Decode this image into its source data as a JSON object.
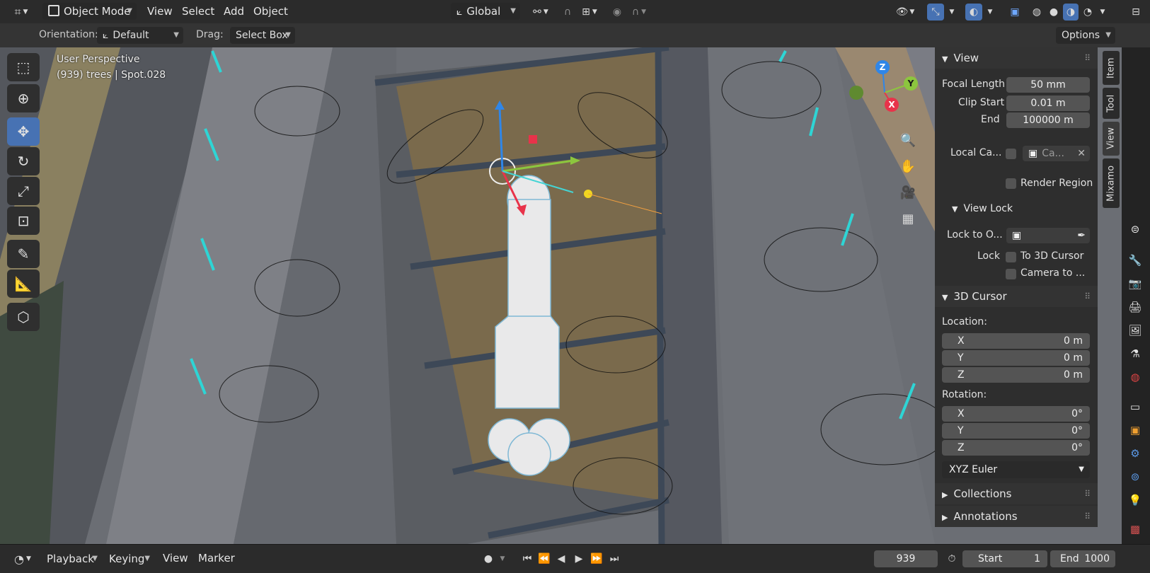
{
  "header": {
    "mode": "Object Mode",
    "menus": [
      "View",
      "Select",
      "Add",
      "Object"
    ],
    "transform_orientation": "Global"
  },
  "tool_options": {
    "orientation_label": "Orientation:",
    "orientation_value": "Default",
    "drag_label": "Drag:",
    "drag_value": "Select Box",
    "options_label": "Options"
  },
  "viewport": {
    "perspective": "User Perspective",
    "object_info": "(939) trees | Spot.028"
  },
  "gizmo_axes": [
    "Z",
    "Y",
    "X"
  ],
  "npanel": {
    "view_header": "View",
    "focal_length_label": "Focal Length",
    "focal_length_value": "50 mm",
    "clip_start_label": "Clip Start",
    "clip_start_value": "0.01 m",
    "clip_end_label": "End",
    "clip_end_value": "100000 m",
    "local_camera_label": "Local Ca...",
    "local_camera_value": "Ca...",
    "render_region_label": "Render Region",
    "view_lock_header": "View Lock",
    "lock_to_object_label": "Lock to O...",
    "lock_label": "Lock",
    "to_3d_cursor_label": "To 3D Cursor",
    "camera_to_label": "Camera to ...",
    "cursor_header": "3D Cursor",
    "location_label": "Location:",
    "location": [
      {
        "axis": "X",
        "value": "0 m"
      },
      {
        "axis": "Y",
        "value": "0 m"
      },
      {
        "axis": "Z",
        "value": "0 m"
      }
    ],
    "rotation_label": "Rotation:",
    "rotation": [
      {
        "axis": "X",
        "value": "0°"
      },
      {
        "axis": "Y",
        "value": "0°"
      },
      {
        "axis": "Z",
        "value": "0°"
      }
    ],
    "rotation_mode": "XYZ Euler",
    "collections_header": "Collections",
    "annotations_header": "Annotations"
  },
  "side_tabs": [
    "Item",
    "Tool",
    "View",
    "Mixamo"
  ],
  "timeline": {
    "menus": [
      "Playback",
      "Keying",
      "View",
      "Marker"
    ],
    "current_frame": "939",
    "start_label": "Start",
    "start_value": "1",
    "end_label": "End",
    "end_value": "1000"
  },
  "colors": {
    "accent": "#4772b3",
    "axis_x": "#e8334a",
    "axis_y": "#8cc63e",
    "axis_z": "#2f86e8"
  }
}
